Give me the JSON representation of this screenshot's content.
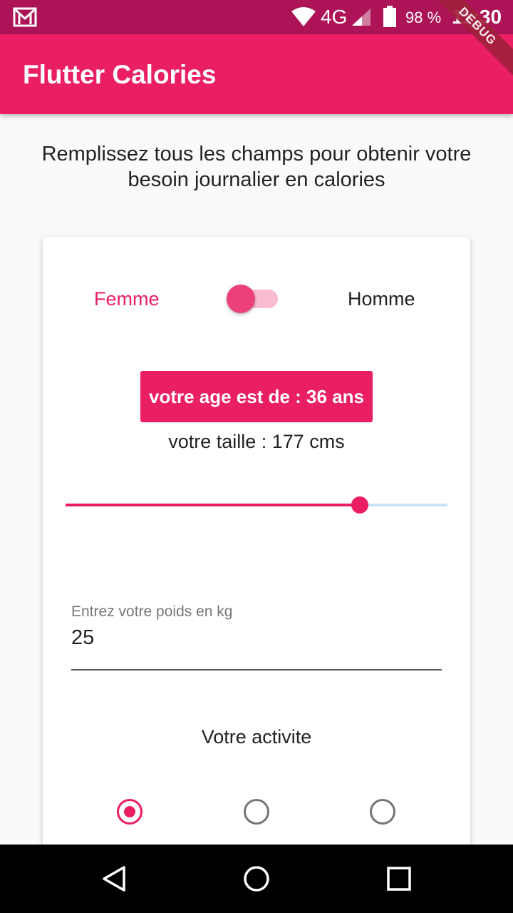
{
  "status_bar": {
    "network": "4G",
    "battery": "98 %",
    "time": "11:30",
    "icons": [
      "gmail-icon",
      "wifi-icon",
      "signal-icon",
      "battery-icon"
    ]
  },
  "debug_banner": "DEBUG",
  "app_bar": {
    "title": "Flutter Calories"
  },
  "intro": "Remplissez tous les champs pour obtenir votre besoin journalier en calories",
  "gender": {
    "female_label": "Femme",
    "male_label": "Homme",
    "switch_on": false
  },
  "age_button": "votre age est de : 36 ans",
  "height": {
    "label": "votre taille : 177 cms",
    "slider_fraction": 0.77
  },
  "weight": {
    "label": "Entrez votre poids en kg",
    "value": "25"
  },
  "activity": {
    "label": "Votre activite",
    "options_selected": [
      true,
      false,
      false
    ]
  },
  "colors": {
    "primary": "#e91e63",
    "status_bar": "#ad1457",
    "slider_inactive": "#c7e3f8"
  },
  "nav_bar": {
    "icons": [
      "back-icon",
      "home-icon",
      "recents-icon"
    ]
  }
}
